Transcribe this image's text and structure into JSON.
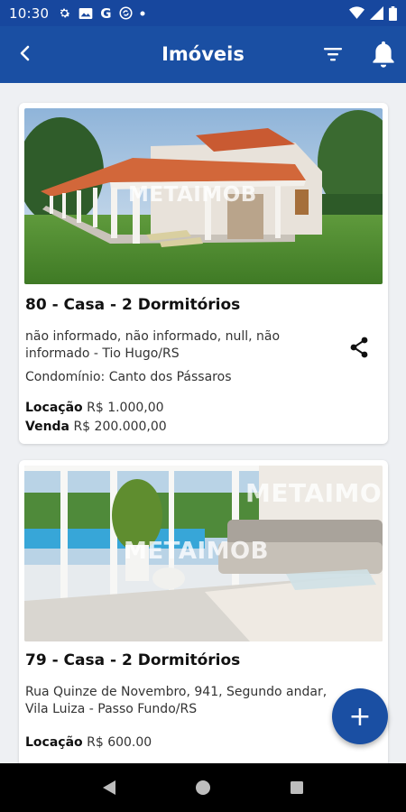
{
  "status_bar": {
    "time": "10:30",
    "google_letter": "G"
  },
  "app_bar": {
    "title": "Imóveis"
  },
  "listings": [
    {
      "title": "80 - Casa - 2 Dormitórios",
      "address": "não informado, não informado, null, não informado - Tio Hugo/RS",
      "condominium": "Condomínio: Canto dos Pássaros",
      "rent_label": "Locação",
      "rent_value": "R$ 1.000,00",
      "sale_label": "Venda",
      "sale_value": "R$ 200.000,00",
      "watermark": "METAIMOB"
    },
    {
      "title": "79 - Casa - 2 Dormitórios",
      "address": "Rua Quinze de Novembro, 941, Segundo andar, Vila Luiza - Passo Fundo/RS",
      "rent_label": "Locação",
      "rent_value": "R$ 600.00",
      "watermark": "METAIMOB"
    }
  ],
  "fab": {
    "label": "+"
  },
  "colors": {
    "primary": "#1a4fa3",
    "status_bar": "#17479e",
    "background": "#eef0f3"
  }
}
